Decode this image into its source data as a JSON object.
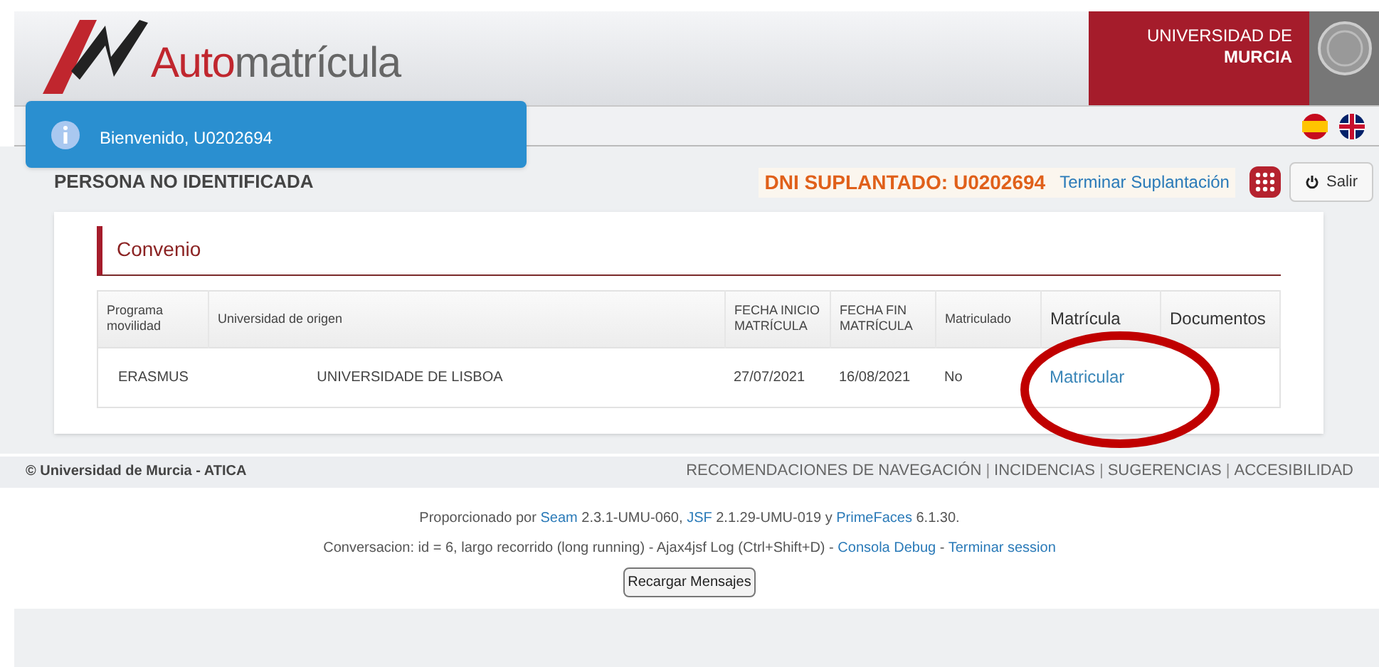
{
  "header": {
    "logo": {
      "prefix": "Auto",
      "rest": "matrícula"
    },
    "university": {
      "line1": "UNIVERSIDAD DE",
      "line2": "MURCIA"
    }
  },
  "toast": {
    "message": "Bienvenido, U0202694"
  },
  "user_bar": {
    "person": "PERSONA NO IDENTIFICADA",
    "impersonation": "DNI SUPLANTADO: U0202694",
    "end_impersonation": "Terminar Suplantación",
    "logout": "Salir"
  },
  "card": {
    "title": "Convenio",
    "table": {
      "columns": [
        {
          "label": "Programa movilidad",
          "large": false
        },
        {
          "label": "Universidad de origen",
          "large": false
        },
        {
          "label": "FECHA INICIO MATRÍCULA",
          "large": false
        },
        {
          "label": "FECHA FIN MATRÍCULA",
          "large": false
        },
        {
          "label": "Matriculado",
          "large": false
        },
        {
          "label": "Matrícula",
          "large": true
        },
        {
          "label": "Documentos",
          "large": true
        }
      ],
      "rows": [
        {
          "programa": "ERASMUS",
          "universidad": "UNIVERSIDADE DE LISBOA",
          "inicio": "27/07/2021",
          "fin": "16/08/2021",
          "matriculado": "No",
          "matricula": "Matricular"
        }
      ]
    }
  },
  "footer": {
    "copyright": "© Universidad de Murcia - ATICA",
    "links": [
      "RECOMENDACIONES DE NAVEGACIÓN",
      "INCIDENCIAS",
      "SUGERENCIAS",
      "ACCESIBILIDAD"
    ],
    "separator": "|"
  },
  "powered": [
    {
      "kind": "text",
      "text": "Proporcionado por "
    },
    {
      "kind": "link",
      "text": "Seam"
    },
    {
      "kind": "text",
      "text": " 2.3.1-UMU-060, "
    },
    {
      "kind": "link",
      "text": "JSF"
    },
    {
      "kind": "text",
      "text": " 2.1.29-UMU-019 y "
    },
    {
      "kind": "link",
      "text": "PrimeFaces"
    },
    {
      "kind": "text",
      "text": " 6.1.30."
    }
  ],
  "conversation": [
    {
      "kind": "text",
      "text": "Conversacion: id = 6, largo recorrido (long running) - Ajax4jsf Log (Ctrl+Shift+D) - "
    },
    {
      "kind": "link",
      "text": "Consola Debug"
    },
    {
      "kind": "text",
      "text": " - "
    },
    {
      "kind": "link",
      "text": "Terminar session"
    }
  ],
  "reload_button": "Recargar Mensajes"
}
